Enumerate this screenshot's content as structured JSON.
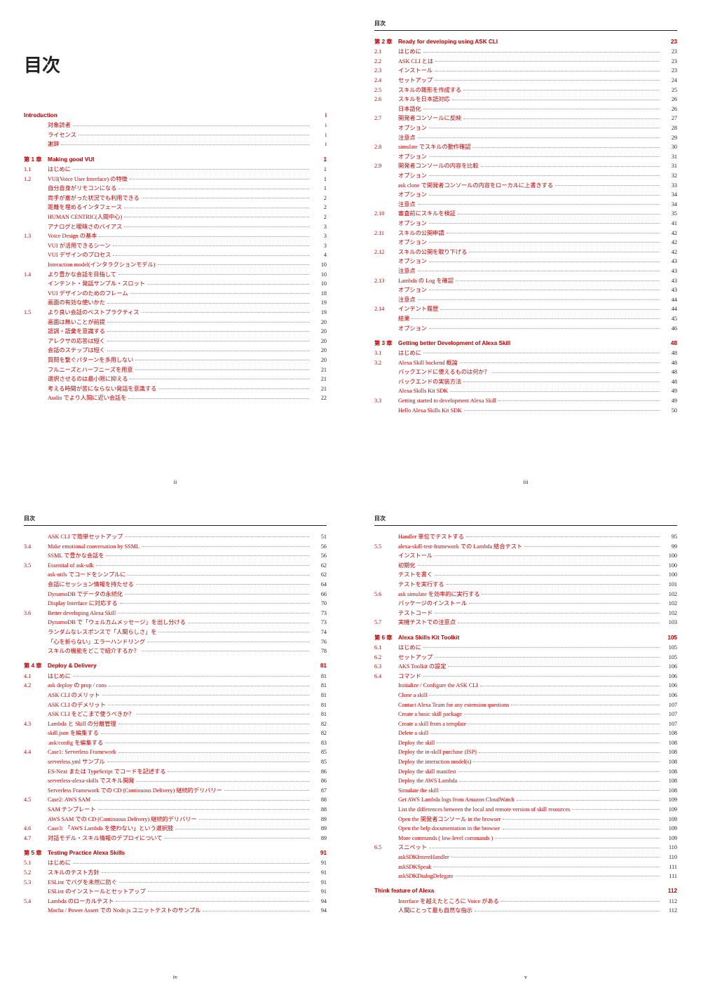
{
  "doc_title": "目次",
  "header_label": "目次",
  "footers": [
    "ii",
    "iii",
    "iv",
    "v"
  ],
  "pages": [
    [
      {
        "t": "title"
      },
      {
        "t": "ch",
        "num": "Introduction",
        "label": "",
        "pg": "i",
        "nonum": true
      },
      {
        "t": "s",
        "num": "",
        "label": "対象読者",
        "pg": "i"
      },
      {
        "t": "s",
        "num": "",
        "label": "ライセンス",
        "pg": "i"
      },
      {
        "t": "s",
        "num": "",
        "label": "謝辞",
        "pg": "i"
      },
      {
        "t": "ch",
        "num": "第 1 章",
        "label": "Making good VUI",
        "pg": "1"
      },
      {
        "t": "s",
        "num": "1.1",
        "label": "はじめに",
        "pg": "1"
      },
      {
        "t": "s",
        "num": "1.2",
        "label": "VUI(Voice User Interface) の特徴",
        "pg": "1"
      },
      {
        "t": "u",
        "label": "自分自身がリモコンになる",
        "pg": "1"
      },
      {
        "t": "u",
        "label": "両手が塞がった状況でも利用できる",
        "pg": "2"
      },
      {
        "t": "u",
        "label": "距離を埋めるインタフェース",
        "pg": "2"
      },
      {
        "t": "u",
        "label": "HUMAN CENTRIC(人間中心)",
        "pg": "2"
      },
      {
        "t": "u",
        "label": "アナログと曖昧さのバイアス",
        "pg": "3"
      },
      {
        "t": "s",
        "num": "1.3",
        "label": "Voice Design の基本",
        "pg": "3"
      },
      {
        "t": "u",
        "label": "VUI が活用できるシーン",
        "pg": "3"
      },
      {
        "t": "u",
        "label": "VUI デザインのプロセス",
        "pg": "4"
      },
      {
        "t": "u",
        "label": "Interaction model(インタラクションモデル)",
        "pg": "10"
      },
      {
        "t": "s",
        "num": "1.4",
        "label": "より豊かな会話を目指して",
        "pg": "10"
      },
      {
        "t": "u",
        "label": "インテント・発話サンプル・スロット",
        "pg": "10"
      },
      {
        "t": "u",
        "label": "VUI デザインのためのフレーム",
        "pg": "18"
      },
      {
        "t": "u",
        "label": "画面の有効な使いかた",
        "pg": "19"
      },
      {
        "t": "s",
        "num": "1.5",
        "label": "より良い会話のベストプラクティス",
        "pg": "19"
      },
      {
        "t": "u",
        "label": "画面は無いことが前提",
        "pg": "20"
      },
      {
        "t": "u",
        "label": "語調・語彙を意識する",
        "pg": "20"
      },
      {
        "t": "u",
        "label": "アレクサの応答は短く",
        "pg": "20"
      },
      {
        "t": "u",
        "label": "会話のステップは短く",
        "pg": "20"
      },
      {
        "t": "u",
        "label": "質問を繋ぐパターンを多用しない",
        "pg": "20"
      },
      {
        "t": "u",
        "label": "フルニーズとハーフニーズを用意",
        "pg": "21"
      },
      {
        "t": "u",
        "label": "選択させるのは最小限に抑える",
        "pg": "21"
      },
      {
        "t": "u",
        "label": "考える時間が苦にならない発話を意識する",
        "pg": "21"
      },
      {
        "t": "u",
        "label": "Audio でより人間に近い会話を",
        "pg": "22"
      }
    ],
    [
      {
        "t": "hdr"
      },
      {
        "t": "ch",
        "num": "第 2 章",
        "label": "Ready for developing using ASK CLI",
        "pg": "23"
      },
      {
        "t": "s",
        "num": "2.1",
        "label": "はじめに",
        "pg": "23"
      },
      {
        "t": "s",
        "num": "2.2",
        "label": "ASK CLI とは",
        "pg": "23"
      },
      {
        "t": "s",
        "num": "2.3",
        "label": "インストール",
        "pg": "23"
      },
      {
        "t": "s",
        "num": "2.4",
        "label": "セットアップ",
        "pg": "24"
      },
      {
        "t": "s",
        "num": "2.5",
        "label": "スキルの雛形を作成する",
        "pg": "25"
      },
      {
        "t": "s",
        "num": "2.6",
        "label": "スキルを日本語対応",
        "pg": "26"
      },
      {
        "t": "u",
        "label": "日本語化",
        "pg": "26"
      },
      {
        "t": "s",
        "num": "2.7",
        "label": "開発者コンソールに反映",
        "pg": "27"
      },
      {
        "t": "u",
        "label": "オプション",
        "pg": "28"
      },
      {
        "t": "u",
        "label": "注意点",
        "pg": "29"
      },
      {
        "t": "s",
        "num": "2.8",
        "label": "simulate でスキルの動作確認",
        "pg": "30"
      },
      {
        "t": "u",
        "label": "オプション",
        "pg": "31"
      },
      {
        "t": "s",
        "num": "2.9",
        "label": "開発者コンソールの内容を比較",
        "pg": "31"
      },
      {
        "t": "u",
        "label": "オプション",
        "pg": "32"
      },
      {
        "t": "u",
        "label": "ask clone で開発者コンソールの内容をローカルに上書きする",
        "pg": "33"
      },
      {
        "t": "u",
        "label": "オプション",
        "pg": "34"
      },
      {
        "t": "u",
        "label": "注意点",
        "pg": "34"
      },
      {
        "t": "s",
        "num": "2.10",
        "label": "審査前にスキルを検証",
        "pg": "35"
      },
      {
        "t": "u",
        "label": "オプション",
        "pg": "41"
      },
      {
        "t": "s",
        "num": "2.11",
        "label": "スキルの公開申請",
        "pg": "42"
      },
      {
        "t": "u",
        "label": "オプション",
        "pg": "42"
      },
      {
        "t": "s",
        "num": "2.12",
        "label": "スキルの公開を取り下げる",
        "pg": "42"
      },
      {
        "t": "u",
        "label": "オプション",
        "pg": "43"
      },
      {
        "t": "u",
        "label": "注意点",
        "pg": "43"
      },
      {
        "t": "s",
        "num": "2.13",
        "label": "Lambda の Log を確認",
        "pg": "43"
      },
      {
        "t": "u",
        "label": "オプション",
        "pg": "43"
      },
      {
        "t": "u",
        "label": "注意点",
        "pg": "44"
      },
      {
        "t": "s",
        "num": "2.14",
        "label": "インテント履歴",
        "pg": "44"
      },
      {
        "t": "u",
        "label": "結果",
        "pg": "45"
      },
      {
        "t": "u",
        "label": "オプション",
        "pg": "46"
      },
      {
        "t": "ch",
        "num": "第 3 章",
        "label": "Getting better Development of Alexa Skill",
        "pg": "48"
      },
      {
        "t": "s",
        "num": "3.1",
        "label": "はじめに",
        "pg": "48"
      },
      {
        "t": "s",
        "num": "3.2",
        "label": "Alexa Skill backend 概論",
        "pg": "48"
      },
      {
        "t": "u",
        "label": "バックエンドに使えるものは何か？",
        "pg": "48"
      },
      {
        "t": "u",
        "label": "バックエンドの実装方法",
        "pg": "48"
      },
      {
        "t": "u",
        "label": "Alexa Skills Kit SDK",
        "pg": "49"
      },
      {
        "t": "s",
        "num": "3.3",
        "label": "Getting started to development Alexa Skill",
        "pg": "49"
      },
      {
        "t": "u",
        "label": "Hello Alexa Skills Kit SDK",
        "pg": "50"
      }
    ],
    [
      {
        "t": "hdr"
      },
      {
        "t": "u",
        "label": "ASK CLI で簡単セットアップ",
        "pg": "51"
      },
      {
        "t": "s",
        "num": "3.4",
        "label": "Make emotional conversation by SSML",
        "pg": "56"
      },
      {
        "t": "u",
        "label": "SSML で豊かな会話を",
        "pg": "56"
      },
      {
        "t": "s",
        "num": "3.5",
        "label": "Essential of ask-sdk",
        "pg": "62"
      },
      {
        "t": "u",
        "label": "ask-utils でコードをシンプルに",
        "pg": "62"
      },
      {
        "t": "u",
        "label": "会話にセッション情報を持たせる",
        "pg": "64"
      },
      {
        "t": "u",
        "label": "DynamoDB でデータの永続化",
        "pg": "66"
      },
      {
        "t": "u",
        "label": "Display Interface に対応する",
        "pg": "70"
      },
      {
        "t": "s",
        "num": "3.6",
        "label": "Better developing Alexa Skill",
        "pg": "73"
      },
      {
        "t": "u",
        "label": "DynamoDB で「ウェルカムメッセージ」を出し分ける",
        "pg": "73"
      },
      {
        "t": "u",
        "label": "ランダムなレスポンスで「人間らしさ」を",
        "pg": "74"
      },
      {
        "t": "u",
        "label": "「心を折らない」エラーハンドリング",
        "pg": "76"
      },
      {
        "t": "u",
        "label": "スキルの機能をどこで紹介するか？",
        "pg": "78"
      },
      {
        "t": "ch",
        "num": "第 4 章",
        "label": "Deploy & Delivery",
        "pg": "81"
      },
      {
        "t": "s",
        "num": "4.1",
        "label": "はじめに",
        "pg": "81"
      },
      {
        "t": "s",
        "num": "4.2",
        "label": "ask deploy の prop / cons",
        "pg": "81"
      },
      {
        "t": "u",
        "label": "ASK CLI のメリット",
        "pg": "81"
      },
      {
        "t": "u",
        "label": "ASK CLI のデメリット",
        "pg": "81"
      },
      {
        "t": "u",
        "label": "ASK CLI をどこまで使うべきか？",
        "pg": "81"
      },
      {
        "t": "s",
        "num": "4.3",
        "label": "Lambda と Skill の分離管理",
        "pg": "82"
      },
      {
        "t": "u",
        "label": "skill.json を編集する",
        "pg": "82"
      },
      {
        "t": "u",
        "label": ".ask/config を編集する",
        "pg": "83"
      },
      {
        "t": "s",
        "num": "4.4",
        "label": "Case1: Serverless Framework",
        "pg": "85"
      },
      {
        "t": "u",
        "label": "serverless.yml サンプル",
        "pg": "85"
      },
      {
        "t": "u",
        "label": "ES-Next または TypeScript でコードを記述する",
        "pg": "86"
      },
      {
        "t": "u",
        "label": "serverless-alexa-skills でスキル開発",
        "pg": "86"
      },
      {
        "t": "u",
        "label": "Serverless Framework での CD (Continuous Delivery) 継続的デリバリー",
        "pg": "87"
      },
      {
        "t": "s",
        "num": "4.5",
        "label": "Case2: AWS SAM",
        "pg": "88"
      },
      {
        "t": "u",
        "label": "SAM テンプレート",
        "pg": "88"
      },
      {
        "t": "u",
        "label": "AWS SAM での CD (Continuous Delivery) 継続的デリバリー",
        "pg": "89"
      },
      {
        "t": "s",
        "num": "4.6",
        "label": "Case3: 「AWS Lambda を使わない」という選択肢",
        "pg": "89"
      },
      {
        "t": "s",
        "num": "4.7",
        "label": "対話モデル・スキル情報のデプロイについて",
        "pg": "89"
      },
      {
        "t": "ch",
        "num": "第 5 章",
        "label": "Testing Practice Alexa Skills",
        "pg": "91"
      },
      {
        "t": "s",
        "num": "5.1",
        "label": "はじめに",
        "pg": "91"
      },
      {
        "t": "s",
        "num": "5.2",
        "label": "スキルのテスト方針",
        "pg": "91"
      },
      {
        "t": "s",
        "num": "5.3",
        "label": "ESLint でバグを未然に防ぐ",
        "pg": "91"
      },
      {
        "t": "u",
        "label": "ESLint のインストールとセットアップ",
        "pg": "91"
      },
      {
        "t": "s",
        "num": "5.4",
        "label": "Lambda のローカルテスト",
        "pg": "94"
      },
      {
        "t": "u",
        "label": "Mocha / Power Assert での Node.js ユニットテストのサンプル",
        "pg": "94"
      }
    ],
    [
      {
        "t": "hdr"
      },
      {
        "t": "u",
        "label": "Handler 単位でテストする",
        "pg": "95"
      },
      {
        "t": "s",
        "num": "5.5",
        "label": "alexa-skill-test-framework での Lambda 結合テスト",
        "pg": "99"
      },
      {
        "t": "u",
        "label": "インストール",
        "pg": "100"
      },
      {
        "t": "u",
        "label": "初期化",
        "pg": "100"
      },
      {
        "t": "u",
        "label": "テストを書く",
        "pg": "100"
      },
      {
        "t": "u",
        "label": "テストを実行する",
        "pg": "101"
      },
      {
        "t": "s",
        "num": "5.6",
        "label": "ask simulate を効率的に実行する",
        "pg": "102"
      },
      {
        "t": "u",
        "label": "パッケージのインストール",
        "pg": "102"
      },
      {
        "t": "u",
        "label": "テストコード",
        "pg": "102"
      },
      {
        "t": "s",
        "num": "5.7",
        "label": "実機テストでの注意点",
        "pg": "103"
      },
      {
        "t": "ch",
        "num": "第 6 章",
        "label": "Alexa Skills Kit Toolkit",
        "pg": "105"
      },
      {
        "t": "s",
        "num": "6.1",
        "label": "はじめに",
        "pg": "105"
      },
      {
        "t": "s",
        "num": "6.2",
        "label": "セットアップ",
        "pg": "105"
      },
      {
        "t": "s",
        "num": "6.3",
        "label": "AKS Toolkit の設定",
        "pg": "106"
      },
      {
        "t": "s",
        "num": "6.4",
        "label": "コマンド",
        "pg": "106"
      },
      {
        "t": "u",
        "label": "Initialize / Configure the ASK CLI",
        "pg": "106"
      },
      {
        "t": "u",
        "label": "Clone a skill",
        "pg": "106"
      },
      {
        "t": "u",
        "label": "Contact Alexa Team for any extension questions",
        "pg": "107"
      },
      {
        "t": "u",
        "label": "Create a basic skill package",
        "pg": "107"
      },
      {
        "t": "u",
        "label": "Create a skill from a template",
        "pg": "107"
      },
      {
        "t": "u",
        "label": "Delete a skill",
        "pg": "108"
      },
      {
        "t": "u",
        "label": "Deploy the skill",
        "pg": "108"
      },
      {
        "t": "u",
        "label": "Deploy the in-skill purchase (ISP)",
        "pg": "108"
      },
      {
        "t": "u",
        "label": "Deploy the interaction model(s)",
        "pg": "108"
      },
      {
        "t": "u",
        "label": "Deploy the skill manifest",
        "pg": "108"
      },
      {
        "t": "u",
        "label": "Deploy the AWS Lambda",
        "pg": "108"
      },
      {
        "t": "u",
        "label": "Simulate the skill",
        "pg": "108"
      },
      {
        "t": "u",
        "label": "Get AWS Lambda logs from Amazon CloudWatch",
        "pg": "109"
      },
      {
        "t": "u",
        "label": "List the differences between the local and remote version of skill resources",
        "pg": "109"
      },
      {
        "t": "u",
        "label": "Open the 開発者コンソール in the browser",
        "pg": "109"
      },
      {
        "t": "u",
        "label": "Open the help documentation in the browser",
        "pg": "109"
      },
      {
        "t": "u",
        "label": "More commands ( low-level commands )",
        "pg": "109"
      },
      {
        "t": "s",
        "num": "6.5",
        "label": "スニペット",
        "pg": "110"
      },
      {
        "t": "u",
        "label": "askSDKIntentHandler",
        "pg": "110"
      },
      {
        "t": "u",
        "label": "askSDKSpeak",
        "pg": "111"
      },
      {
        "t": "u",
        "label": "askSDKDialogDelegate",
        "pg": "111"
      },
      {
        "t": "ch",
        "num": "Think feature of Alexa",
        "label": "",
        "pg": "112",
        "nonum": true
      },
      {
        "t": "s",
        "num": "",
        "label": "Interface を越えたところに Voice がある",
        "pg": "112"
      },
      {
        "t": "s",
        "num": "",
        "label": "人間にとって最も自然な指示",
        "pg": "112"
      }
    ]
  ]
}
